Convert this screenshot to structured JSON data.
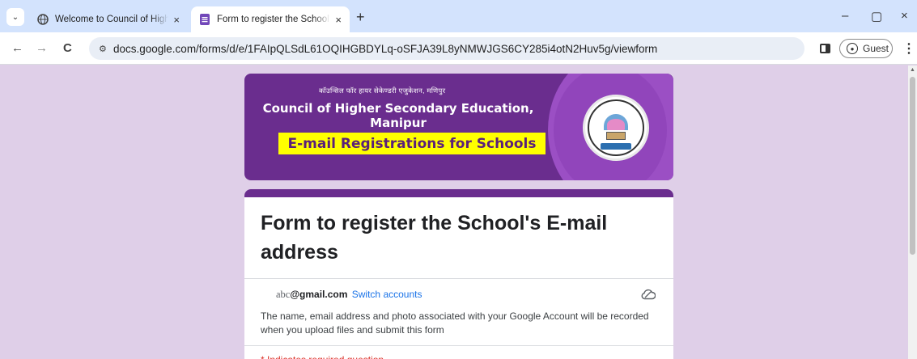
{
  "browser": {
    "tabs": [
      {
        "title": "Welcome to Council of Higher S",
        "close": "×"
      },
      {
        "title": "Form to register the School's E-",
        "close": "×"
      }
    ],
    "new_tab": "+",
    "window_controls": [
      "–",
      "▢",
      "×"
    ],
    "url": "docs.google.com/forms/d/e/1FAIpQLSdL61OQIHGBDYLq-oSFJA39L8yNMWJGS6CY285i4otN2Huv5g/viewform",
    "profile_label": "Guest",
    "icons": {
      "back": "←",
      "forward": "→",
      "reload": "C",
      "site_info": "⚙",
      "menu": "⋮",
      "tab_search": "⌄"
    }
  },
  "header_image": {
    "hindi_line": "कॉउन्सिल फॉर हायर सेकेण्डरी एजुकेशन, मणिपुर",
    "council_name": "Council of Higher Secondary Education, Manipur",
    "banner_text": "E-mail Registrations for Schools"
  },
  "form": {
    "title": "Form to register the School's E-mail address",
    "account_prefix": "abc",
    "account_email": "@gmail.com",
    "switch_accounts": "Switch accounts",
    "notice": "The name, email address and photo associated with your Google Account will be recorded when you upload files and submit this form",
    "required_note": "* Indicates required question"
  },
  "colors": {
    "theme": "#6a2d8e",
    "page_bg": "#dfcfe8",
    "banner": "#ffff00",
    "link": "#1a73e8",
    "required": "#d93025"
  }
}
